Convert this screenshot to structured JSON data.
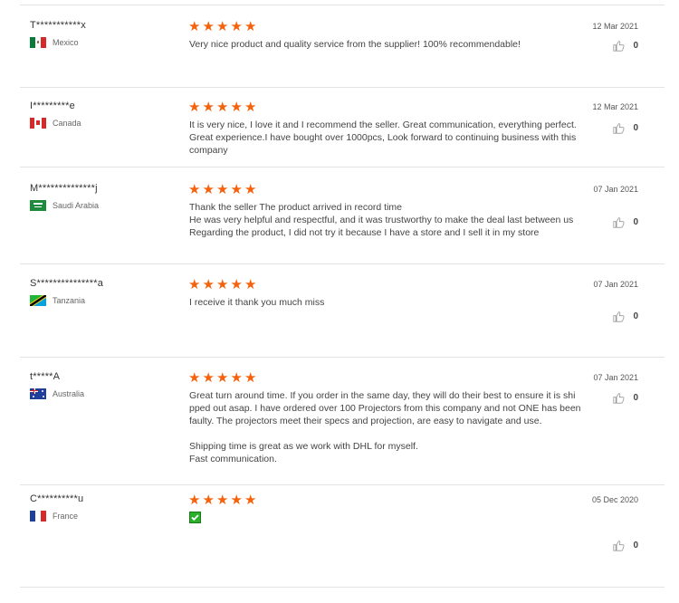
{
  "reviews": [
    {
      "user": "T***********x",
      "country": "Mexico",
      "rating": 5,
      "date": "12 Mar 2021",
      "text": "Very nice product and quality service from the supplier! 100% recommendable!",
      "likes": "0"
    },
    {
      "user": "I*********e",
      "country": "Canada",
      "rating": 5,
      "date": "12 Mar 2021",
      "text": "It is very nice, I love it and I recommend the seller. Great communication, everything perfect.\nGreat experience.I have bought over 1000pcs, Look forward to continuing business with this\ncompany",
      "likes": "0"
    },
    {
      "user": "M**************j",
      "country": "Saudi Arabia",
      "rating": 5,
      "date": "07 Jan 2021",
      "text": "Thank the seller The product arrived in record time\nHe was very helpful and respectful, and it was trustworthy to make the deal last between us\nRegarding the product, I did not try it because I have a store and I sell it in my store",
      "likes": "0"
    },
    {
      "user": "S***************a",
      "country": "Tanzania",
      "rating": 5,
      "date": "07 Jan 2021",
      "text": "I receive it thank you much miss",
      "likes": "0"
    },
    {
      "user": "t*****A",
      "country": "Australia",
      "rating": 5,
      "date": "07 Jan 2021",
      "text": "Great turn around time. If you order in the same day, they will do their best to ensure it is shi\npped out asap. I have ordered over 100 Projectors from this company and not ONE has been\nfaulty.  The projectors meet their specs and projection, are easy to navigate and use.\n\nShipping time is great as we work with DHL for myself.\nFast communication.",
      "likes": "0"
    },
    {
      "user": "C**********u",
      "country": "France",
      "rating": 5,
      "date": "05 Dec 2020",
      "text": "",
      "likes": "0"
    }
  ],
  "colors": {
    "star": "#f4620c",
    "separator": "#e3e3e3"
  },
  "icons": {
    "rating": "star-icon",
    "like": "thumbs-up-icon",
    "flag": "flag-icon",
    "check": "checkmark-icon"
  }
}
